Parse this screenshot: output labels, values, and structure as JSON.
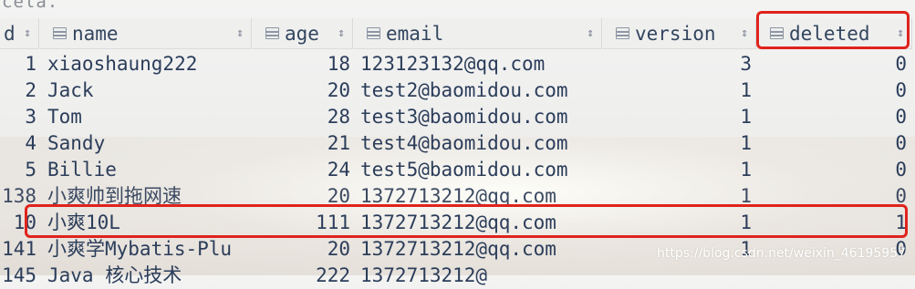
{
  "title_fragment": "cela.",
  "columns": {
    "id": "d",
    "name": "name",
    "age": "age",
    "email": "email",
    "version": "version",
    "deleted": "deleted"
  },
  "rows": [
    {
      "id": "1",
      "name": "xiaoshaung222",
      "age": "18",
      "email": "123123132@qq.com",
      "version": "3",
      "deleted": "0"
    },
    {
      "id": "2",
      "name": "Jack",
      "age": "20",
      "email": "test2@baomidou.com",
      "version": "1",
      "deleted": "0"
    },
    {
      "id": "3",
      "name": "Tom",
      "age": "28",
      "email": "test3@baomidou.com",
      "version": "1",
      "deleted": "0"
    },
    {
      "id": "4",
      "name": "Sandy",
      "age": "21",
      "email": "test4@baomidou.com",
      "version": "1",
      "deleted": "0"
    },
    {
      "id": "5",
      "name": "Billie",
      "age": "24",
      "email": "test5@baomidou.com",
      "version": "1",
      "deleted": "0"
    },
    {
      "id": "138",
      "name": "小爽帅到拖网速",
      "age": "20",
      "email": "1372713212@qq.com",
      "version": "1",
      "deleted": "0"
    },
    {
      "id": "10",
      "name": "小爽10L",
      "age": "111",
      "email": "1372713212@qq.com",
      "version": "1",
      "deleted": "1"
    },
    {
      "id": "141",
      "name": "小爽学Mybatis-Plu",
      "age": "20",
      "email": "1372713212@qq.com",
      "version": "1",
      "deleted": "0"
    },
    {
      "id": "145",
      "name": "Java 核心技术",
      "age": "222",
      "email": "1372713212@",
      "version": "",
      "deleted": ""
    }
  ],
  "watermark": "https://blog.csdn.net/weixin_46195957",
  "colors": {
    "highlight_border": "#e0231d",
    "text": "#2b3d5a",
    "header_bg": "#eeeeed"
  }
}
